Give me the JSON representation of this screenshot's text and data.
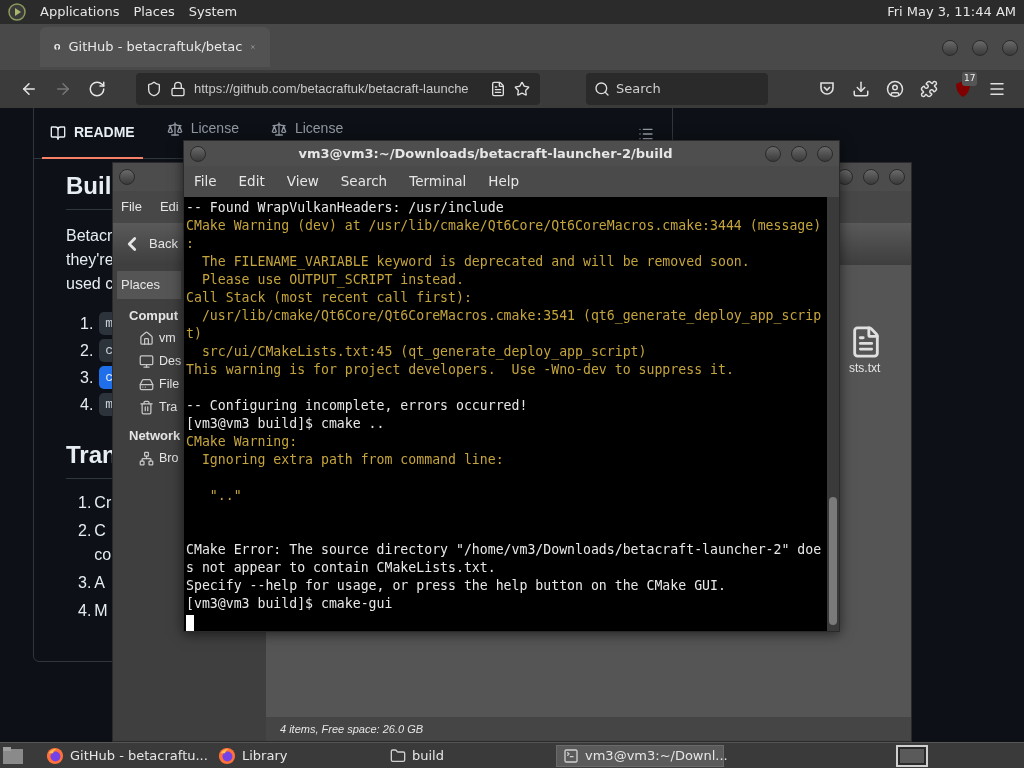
{
  "top_panel": {
    "menus": [
      "Applications",
      "Places",
      "System"
    ],
    "clock": "Fri May 3, 11:44 AM"
  },
  "browser": {
    "tabs": [
      {
        "title": "GitHub - betacraftuk/betac",
        "selected": true
      }
    ],
    "nav_buttons": [
      {
        "kind": "back",
        "disabled": false
      },
      {
        "kind": "forward",
        "disabled": true
      },
      {
        "kind": "reload",
        "disabled": false
      }
    ],
    "url": "https://github.com/betacraftuk/betacraft-launche",
    "search": {
      "placeholder": "Search"
    },
    "addon_badge": "17"
  },
  "page": {
    "tabs": [
      {
        "label": "README",
        "kind": "book",
        "selected": true
      },
      {
        "label": "License",
        "kind": "scale",
        "selected": false
      },
      {
        "label": "License",
        "kind": "scale",
        "selected": false
      }
    ],
    "heading_1": "Buil",
    "paragraph_lines": [
      "Betacr",
      "they're",
      "used c"
    ],
    "steps": [
      {
        "number": "1.",
        "code": "m",
        "highlighted": false
      },
      {
        "number": "2.",
        "code": "c",
        "highlighted": false
      },
      {
        "number": "3.",
        "code": "c",
        "highlighted": true
      },
      {
        "number": "4.",
        "code": "m",
        "highlighted": false
      }
    ],
    "heading_2": "Tran",
    "steps_2": [
      {
        "number": "1.",
        "lines": [
          "Cr"
        ]
      },
      {
        "number": "2.",
        "lines": [
          "C",
          "co"
        ]
      },
      {
        "number": "3.",
        "lines": [
          "A"
        ]
      },
      {
        "number": "4.",
        "lines": [
          "M"
        ]
      }
    ]
  },
  "file_manager": {
    "menus": [
      "File",
      "Edi"
    ],
    "back": "Back",
    "places_label": "Places",
    "sections": [
      {
        "title": "Comput",
        "items": [
          {
            "label": "vm",
            "kind": "home"
          },
          {
            "label": "Des",
            "kind": "desktop"
          },
          {
            "label": "File",
            "kind": "drive"
          },
          {
            "label": "Tra",
            "kind": "trash"
          }
        ]
      },
      {
        "title": "Network",
        "items": [
          {
            "label": "Bro",
            "kind": "network"
          }
        ]
      }
    ],
    "file_label": "sts.txt",
    "status": "4 items, Free space: 26.0 GB"
  },
  "terminal": {
    "title": "vm3@vm3:~/Downloads/betacraft-launcher-2/build",
    "menus": [
      "File",
      "Edit",
      "View",
      "Search",
      "Terminal",
      "Help"
    ],
    "lines": [
      {
        "kind": "normal",
        "text": "-- Found WrapVulkanHeaders: /usr/include"
      },
      {
        "kind": "warning",
        "text": "CMake Warning (dev) at /usr/lib/cmake/Qt6Core/Qt6CoreMacros.cmake:3444 (message)"
      },
      {
        "kind": "warning",
        "text": ":"
      },
      {
        "kind": "warning",
        "text": "  The FILENAME_VARIABLE keyword is deprecated and will be removed soon."
      },
      {
        "kind": "warning",
        "text": "  Please use OUTPUT_SCRIPT instead."
      },
      {
        "kind": "warning",
        "text": "Call Stack (most recent call first):"
      },
      {
        "kind": "warning",
        "text": "  /usr/lib/cmake/Qt6Core/Qt6CoreMacros.cmake:3541 (qt6_generate_deploy_app_scrip"
      },
      {
        "kind": "warning",
        "text": "t)"
      },
      {
        "kind": "warning",
        "text": "  src/ui/CMakeLists.txt:45 (qt_generate_deploy_app_script)"
      },
      {
        "kind": "warning",
        "text": "This warning is for project developers.  Use -Wno-dev to suppress it."
      },
      {
        "kind": "blank"
      },
      {
        "kind": "normal",
        "text": "-- Configuring incomplete, errors occurred!"
      },
      {
        "kind": "normal",
        "text": "[vm3@vm3 build]$ cmake .."
      },
      {
        "kind": "warning",
        "text": "CMake Warning:"
      },
      {
        "kind": "warning",
        "text": "  Ignoring extra path from command line:"
      },
      {
        "kind": "blank"
      },
      {
        "kind": "warning",
        "text": "   \"..\""
      },
      {
        "kind": "blank"
      },
      {
        "kind": "blank"
      },
      {
        "kind": "normal",
        "text": "CMake Error: The source directory \"/home/vm3/Downloads/betacraft-launcher-2\" doe"
      },
      {
        "kind": "normal",
        "text": "s not appear to contain CMakeLists.txt."
      },
      {
        "kind": "normal",
        "text": "Specify --help for usage, or press the help button on the CMake GUI."
      },
      {
        "kind": "normal",
        "text": "[vm3@vm3 build]$ cmake-gui"
      }
    ]
  },
  "taskbar": {
    "items": [
      {
        "kind": "firefox",
        "label": "GitHub - betacraftu...",
        "selected": false
      },
      {
        "kind": "firefox",
        "label": "Library",
        "selected": false
      },
      {
        "kind": "folder",
        "label": "build",
        "selected": false
      },
      {
        "kind": "terminal",
        "label": "vm3@vm3:~/Downl...",
        "selected": true
      }
    ]
  }
}
